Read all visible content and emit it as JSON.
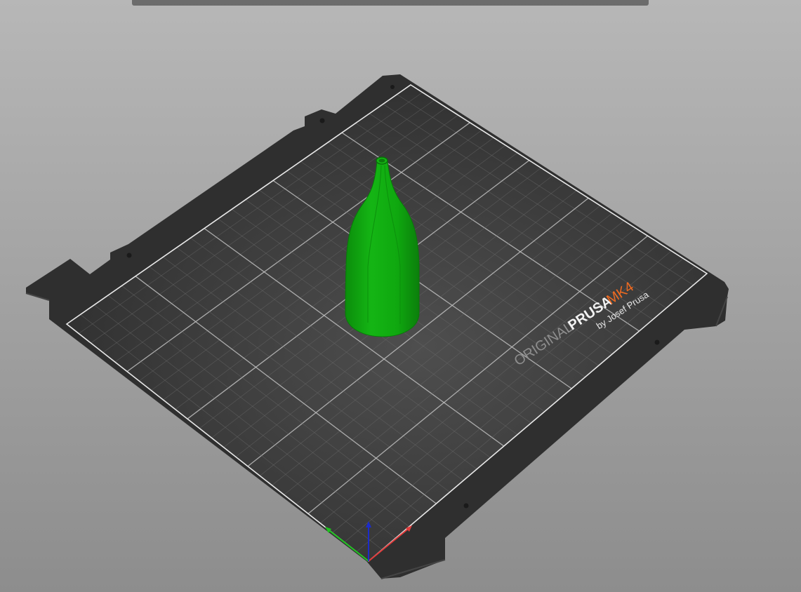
{
  "bed": {
    "brand_original": "ORIGINAL",
    "brand_prusa": "PRUSA",
    "brand_model": "MK4",
    "brand_byline": "by Josef Prusa"
  },
  "colors": {
    "background": "#a9a9a9",
    "bed_frame": "#2f2f2f",
    "bed_surface": "#3b3b3b",
    "grid_minor": "#6b6b6b",
    "grid_major": "#bfbfbf",
    "bed_border": "#e8e8e8",
    "model_green": "#10a310",
    "brand_gray": "#8e8e8e",
    "brand_white": "#f2f2f2",
    "brand_orange": "#ef6a20",
    "axis_x": "#e03b3b",
    "axis_y": "#1fc21f",
    "axis_z": "#1c2cc9"
  },
  "icons": {
    "axis": "xyz-axis-icon",
    "model": "bottle-model-icon"
  }
}
